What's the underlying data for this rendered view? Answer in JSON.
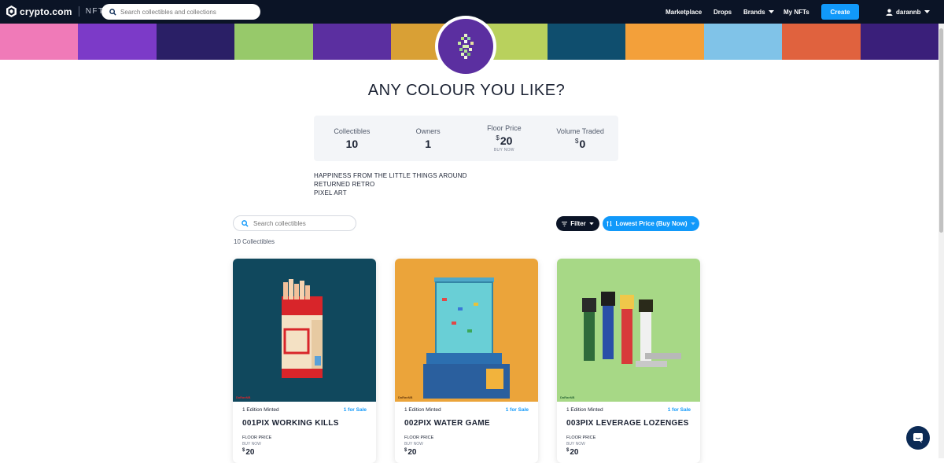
{
  "header": {
    "brand": "crypto.com",
    "product": "NFT",
    "search_placeholder": "Search collectibles and collections",
    "nav": [
      "Marketplace",
      "Drops",
      "Brands",
      "My NFTs"
    ],
    "create_label": "Create",
    "username": "darannb"
  },
  "banner_colors": [
    "#f07ab8",
    "#7c3ac8",
    "#2a1f66",
    "#97c96a",
    "#5b2fa0",
    "#d9a035",
    "#b9d15d",
    "#0f4e6e",
    "#f3a03a",
    "#80c3e8",
    "#e0623e",
    "#3a1f7a"
  ],
  "collection": {
    "title": "ANY COLOUR YOU LIKE?",
    "stats": [
      {
        "label": "Collectibles",
        "value": "10"
      },
      {
        "label": "Owners",
        "value": "1"
      },
      {
        "label": "Floor Price",
        "currency": "$",
        "value": "20",
        "sub": "BUY NOW"
      },
      {
        "label": "Volume Traded",
        "currency": "$",
        "value": "0"
      }
    ],
    "description": [
      "HAPPINESS FROM THE LITTLE THINGS AROUND",
      "RETURNED RETRO",
      "PIXEL ART"
    ]
  },
  "toolbar": {
    "search_placeholder": "Search collectibles",
    "count_label": "10 Collectibles",
    "filter_label": "Filter",
    "sort_label": "Lowest Price (Buy Now)"
  },
  "cards": [
    {
      "edition": "1 Edition Minted",
      "sale": "1 for Sale",
      "name": "001PIX WORKING KILLS",
      "floor_label": "FLOOR PRICE",
      "buy_label": "BUY NOW",
      "currency": "$",
      "price": "20",
      "bg": "#10485d",
      "sig": "DaRanNB"
    },
    {
      "edition": "1 Edition Minted",
      "sale": "1 for Sale",
      "name": "002PIX WATER GAME",
      "floor_label": "FLOOR PRICE",
      "buy_label": "BUY NOW",
      "currency": "$",
      "price": "20",
      "bg": "#eba43a",
      "sig": "DaRanNB"
    },
    {
      "edition": "1 Edition Minted",
      "sale": "1 for Sale",
      "name": "003PIX LEVERAGE LOZENGES",
      "floor_label": "FLOOR PRICE",
      "buy_label": "BUY NOW",
      "currency": "$",
      "price": "20",
      "bg": "#a7d886",
      "sig": "DaRanNB"
    }
  ]
}
